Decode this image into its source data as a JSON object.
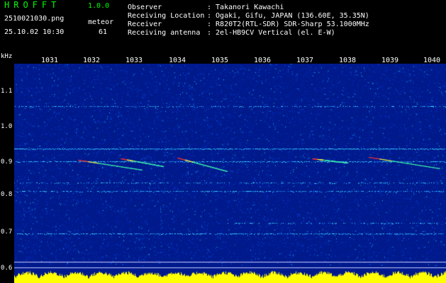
{
  "app": {
    "title": "HROFFT",
    "version": "1.0.0"
  },
  "file": {
    "name": "2510021030.png",
    "mode": "meteor",
    "datetime": "25.10.02 10:30",
    "count": "61"
  },
  "info": [
    {
      "key": "Observer",
      "value": ": Takanori Kawachi"
    },
    {
      "key": "Receiving Location",
      "value": ": Ogaki, Gifu, JAPAN (136.60E, 35.35N)"
    },
    {
      "key": "Receiver",
      "value": ": R820T2(RTL-SDR) SDR-Sharp 53.1000MHz"
    },
    {
      "key": "Receiving antenna",
      "value": ": 2el-HB9CV Vertical (el. E-W)"
    }
  ],
  "axis": {
    "unit": "kHz",
    "x_ticks": [
      "1031",
      "1032",
      "1033",
      "1034",
      "1035",
      "1036",
      "1037",
      "1038",
      "1039",
      "1040"
    ],
    "y_ticks": [
      "1.1",
      "1.0",
      "0.9",
      "0.8",
      "0.7",
      "0.6"
    ]
  },
  "colors": {
    "background": "#001a8c",
    "signal": "#00ffff",
    "peak": "#ff3030",
    "meter": "#ffff00"
  }
}
